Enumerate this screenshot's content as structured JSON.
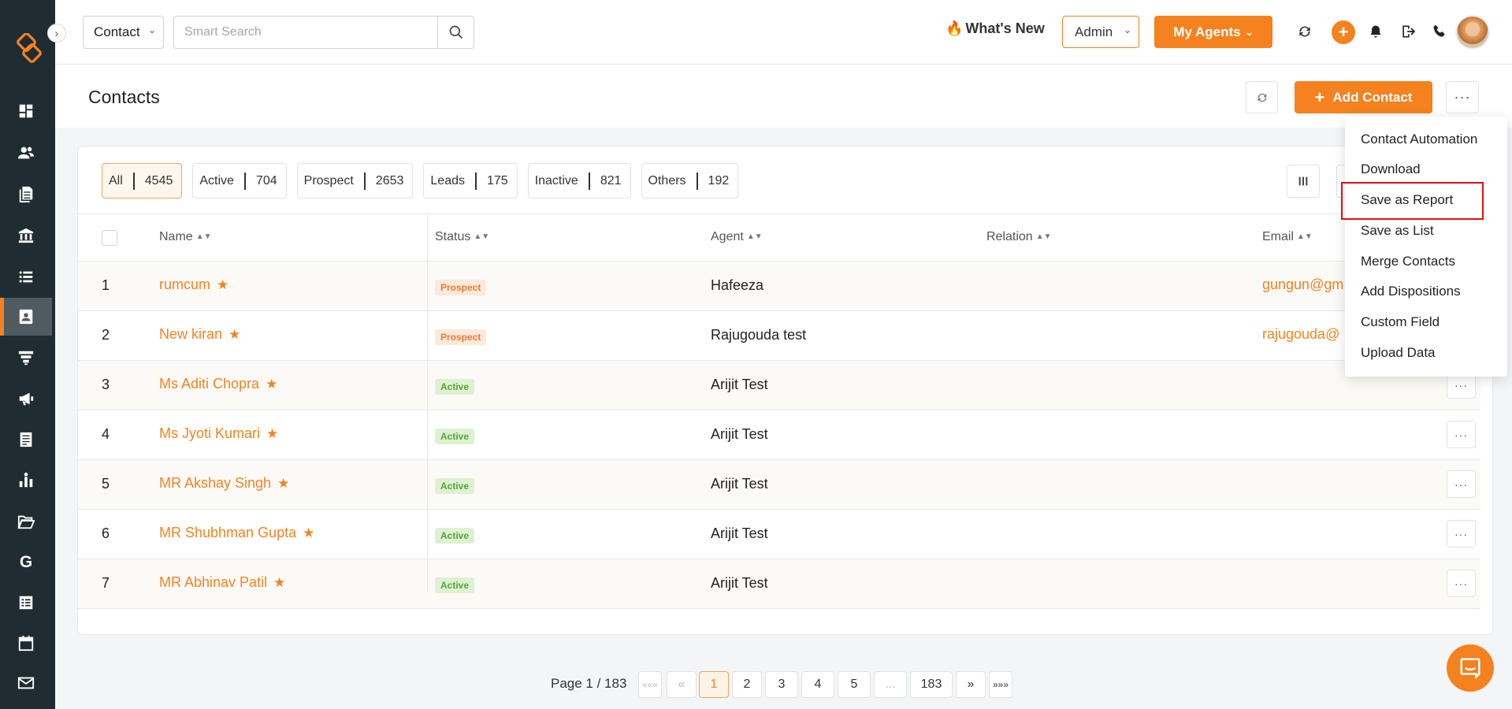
{
  "topbar": {
    "module_select": "Contact",
    "search_placeholder": "Smart Search",
    "whats_new": "What's New",
    "whats_new_emoji": "🔥",
    "role_select": "Admin",
    "my_agents": "My Agents",
    "plus": "+"
  },
  "page": {
    "title": "Contacts",
    "add_contact": "Add Contact",
    "more": "···"
  },
  "filters": [
    {
      "label": "All",
      "count": "4545"
    },
    {
      "label": "Active",
      "count": "704"
    },
    {
      "label": "Prospect",
      "count": "2653"
    },
    {
      "label": "Leads",
      "count": "175"
    },
    {
      "label": "Inactive",
      "count": "821"
    },
    {
      "label": "Others",
      "count": "192"
    }
  ],
  "table": {
    "headers": {
      "name": "Name",
      "status": "Status",
      "agent": "Agent",
      "relation": "Relation",
      "email": "Email"
    },
    "rows": [
      {
        "num": "1",
        "name": "rumcum",
        "status": "Prospect",
        "agent": "Hafeeza",
        "email": "gungun@gm"
      },
      {
        "num": "2",
        "name": "New kiran",
        "status": "Prospect",
        "agent": "Rajugouda test",
        "email": "rajugouda@"
      },
      {
        "num": "3",
        "name": "Ms Aditi Chopra",
        "status": "Active",
        "agent": "Arijit Test",
        "email": ""
      },
      {
        "num": "4",
        "name": "Ms Jyoti Kumari",
        "status": "Active",
        "agent": "Arijit Test",
        "email": ""
      },
      {
        "num": "5",
        "name": "MR Akshay Singh",
        "status": "Active",
        "agent": "Arijit Test",
        "email": ""
      },
      {
        "num": "6",
        "name": "MR Shubhman Gupta",
        "status": "Active",
        "agent": "Arijit Test",
        "email": ""
      },
      {
        "num": "7",
        "name": "MR Abhinav Patil",
        "status": "Active",
        "agent": "Arijit Test",
        "email": ""
      }
    ],
    "row_more": "···"
  },
  "pagination": {
    "info": "Page 1 / 183",
    "first": "«««",
    "prev": "«",
    "pages": [
      "1",
      "2",
      "3",
      "4",
      "5",
      "...",
      "183"
    ],
    "next": "»",
    "last": "»»»"
  },
  "menu": {
    "items": [
      "Contact Automation",
      "Download",
      "Save as Report",
      "Save as List",
      "Merge Contacts",
      "Add Dispositions",
      "Custom Field",
      "Upload Data"
    ]
  },
  "colors": {
    "accent": "#f5821f",
    "sidebar": "#1f2d33",
    "highlight": "#dd1111"
  }
}
